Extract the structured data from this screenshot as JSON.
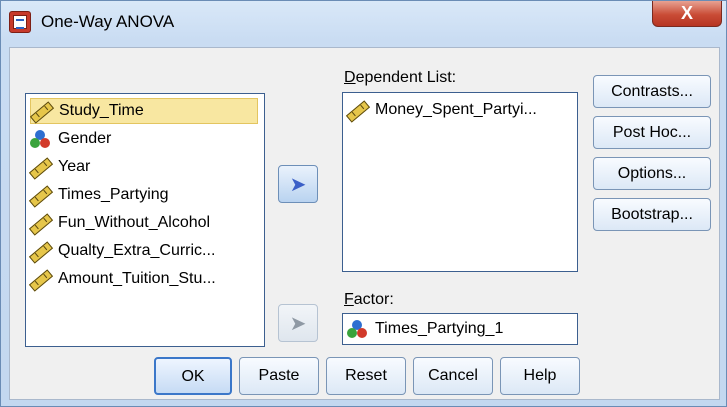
{
  "window": {
    "title": "One-Way ANOVA",
    "close_label": "X"
  },
  "variables": [
    {
      "name": "Study_Time",
      "icon": "ruler-icon",
      "selected": true
    },
    {
      "name": "Gender",
      "icon": "nominal-balls-icon",
      "selected": false
    },
    {
      "name": "Year",
      "icon": "ruler-icon",
      "selected": false
    },
    {
      "name": "Times_Partying",
      "icon": "ruler-icon",
      "selected": false
    },
    {
      "name": "Fun_Without_Alcohol",
      "icon": "ruler-icon",
      "selected": false
    },
    {
      "name": "Qualty_Extra_Curric...",
      "icon": "ruler-icon",
      "selected": false
    },
    {
      "name": "Amount_Tuition_Stu...",
      "icon": "ruler-icon",
      "selected": false
    }
  ],
  "dependent": {
    "label": "Dependent List:",
    "items": [
      {
        "name": "Money_Spent_Partyi...",
        "icon": "ruler-icon"
      }
    ]
  },
  "factor": {
    "label": "Factor:",
    "value": "Times_Partying_1",
    "icon": "nominal-balls-icon"
  },
  "side_buttons": [
    "Contrasts...",
    "Post Hoc...",
    "Options...",
    "Bootstrap..."
  ],
  "bottom_buttons": [
    "OK",
    "Paste",
    "Reset",
    "Cancel",
    "Help"
  ]
}
